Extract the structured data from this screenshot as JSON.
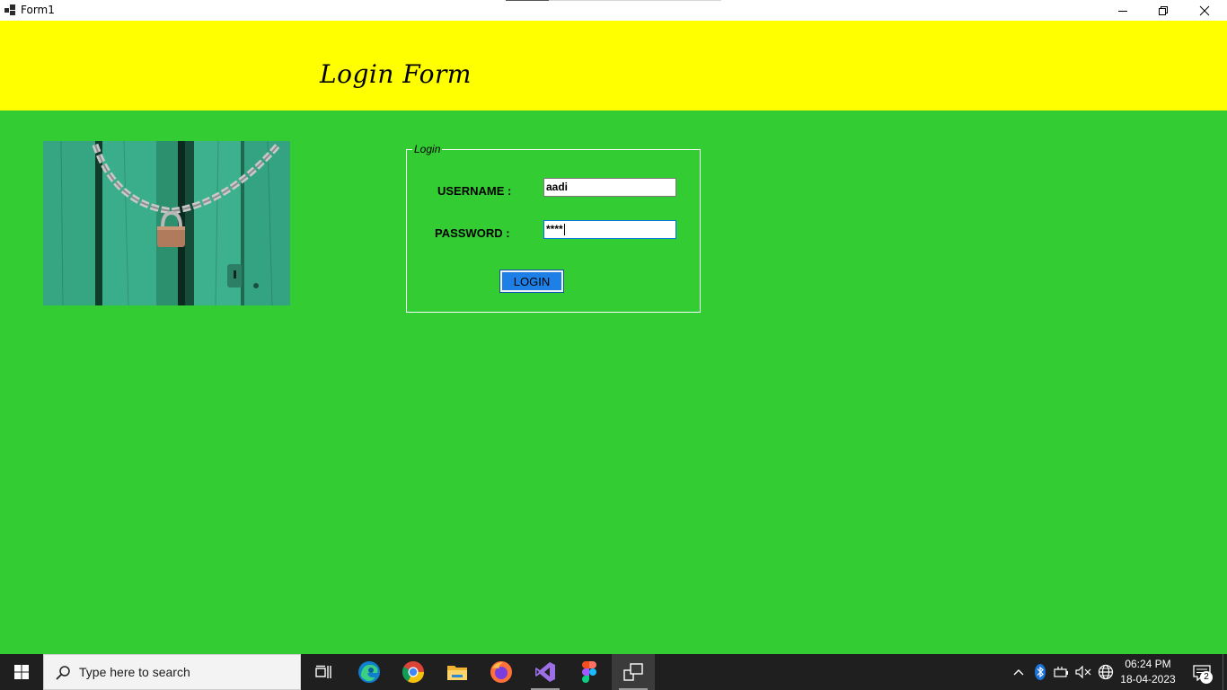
{
  "window": {
    "title": "Form1"
  },
  "header": {
    "title": "Login Form",
    "background": "#ffff00"
  },
  "content": {
    "background": "#33cc33"
  },
  "login_group": {
    "legend": "Login",
    "username_label": "USERNAME :",
    "username_value": "aadi",
    "password_label": "PASSWORD :",
    "password_value": "****",
    "login_button": "LOGIN",
    "button_color": "#1e7fe6"
  },
  "image": {
    "icon": "padlock-chain-image"
  },
  "taskbar": {
    "search_placeholder": "Type here to search",
    "apps": [
      "task-view",
      "edge",
      "chrome",
      "file-explorer",
      "firefox",
      "visual-studio",
      "figma",
      "form-app"
    ],
    "clock_time": "06:24 PM",
    "clock_date": "18-04-2023",
    "notification_count": "2"
  }
}
